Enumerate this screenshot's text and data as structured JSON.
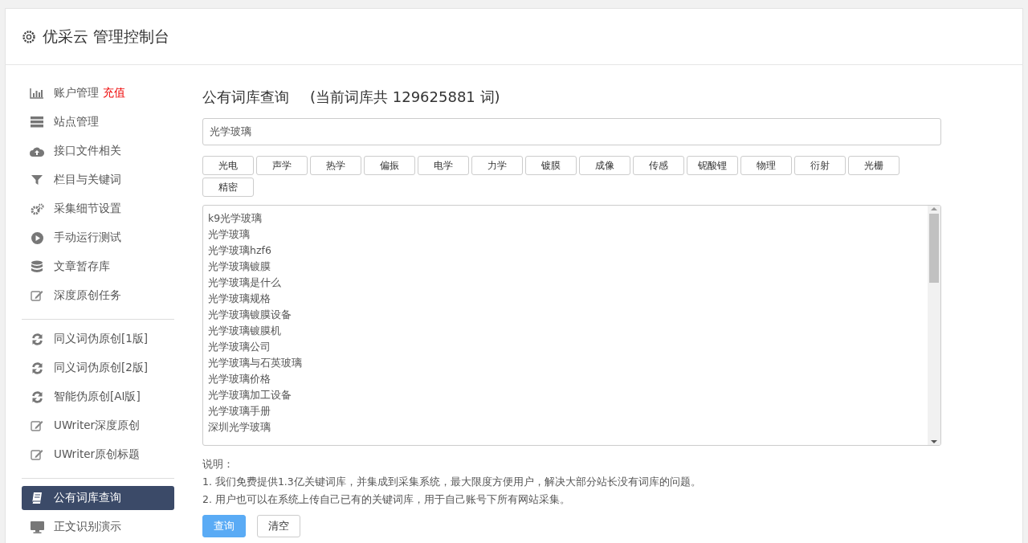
{
  "header": {
    "title": "优采云 管理控制台"
  },
  "sidebar": {
    "groups": [
      {
        "items": [
          {
            "label": "账户管理",
            "badge": "充值",
            "selected": false
          },
          {
            "label": "站点管理",
            "selected": false
          },
          {
            "label": "接口文件相关",
            "selected": false
          },
          {
            "label": "栏目与关键词",
            "selected": false
          },
          {
            "label": "采集细节设置",
            "selected": false
          },
          {
            "label": "手动运行测试",
            "selected": false
          },
          {
            "label": "文章暂存库",
            "selected": false
          },
          {
            "label": "深度原创任务",
            "selected": false
          }
        ]
      },
      {
        "items": [
          {
            "label": "同义词伪原创[1版]",
            "selected": false
          },
          {
            "label": "同义词伪原创[2版]",
            "selected": false
          },
          {
            "label": "智能伪原创[AI版]",
            "selected": false
          },
          {
            "label": "UWriter深度原创",
            "selected": false
          },
          {
            "label": "UWriter原创标题",
            "selected": false
          }
        ]
      },
      {
        "items": [
          {
            "label": "公有词库查询",
            "selected": true
          },
          {
            "label": "正文识别演示",
            "selected": false
          }
        ]
      }
    ]
  },
  "main": {
    "title": "公有词库查询",
    "count_note": "(当前词库共 129625881 词)",
    "query": {
      "value": "光学玻璃"
    },
    "tags": [
      "光电",
      "声学",
      "热学",
      "偏振",
      "电学",
      "力学",
      "镀膜",
      "成像",
      "传感",
      "铌酸锂",
      "物理",
      "衍射",
      "光栅",
      "精密"
    ],
    "results": [
      "k9光学玻璃",
      "光学玻璃",
      "光学玻璃hzf6",
      "光学玻璃镀膜",
      "光学玻璃是什么",
      "光学玻璃规格",
      "光学玻璃镀膜设备",
      "光学玻璃镀膜机",
      "光学玻璃公司",
      "光学玻璃与石英玻璃",
      "光学玻璃价格",
      "光学玻璃加工设备",
      "光学玻璃手册",
      "深圳光学玻璃"
    ],
    "notes_title": "说明：",
    "notes": [
      "1. 我们免费提供1.3亿关键词库，并集成到采集系统，最大限度方便用户，解决大部分站长没有词库的问题。",
      "2. 用户也可以在系统上传自己已有的关键词库，用于自己账号下所有网站采集。"
    ],
    "buttons": [
      {
        "label": "查询",
        "kind": "primary"
      },
      {
        "label": "清空",
        "kind": "default"
      }
    ]
  }
}
